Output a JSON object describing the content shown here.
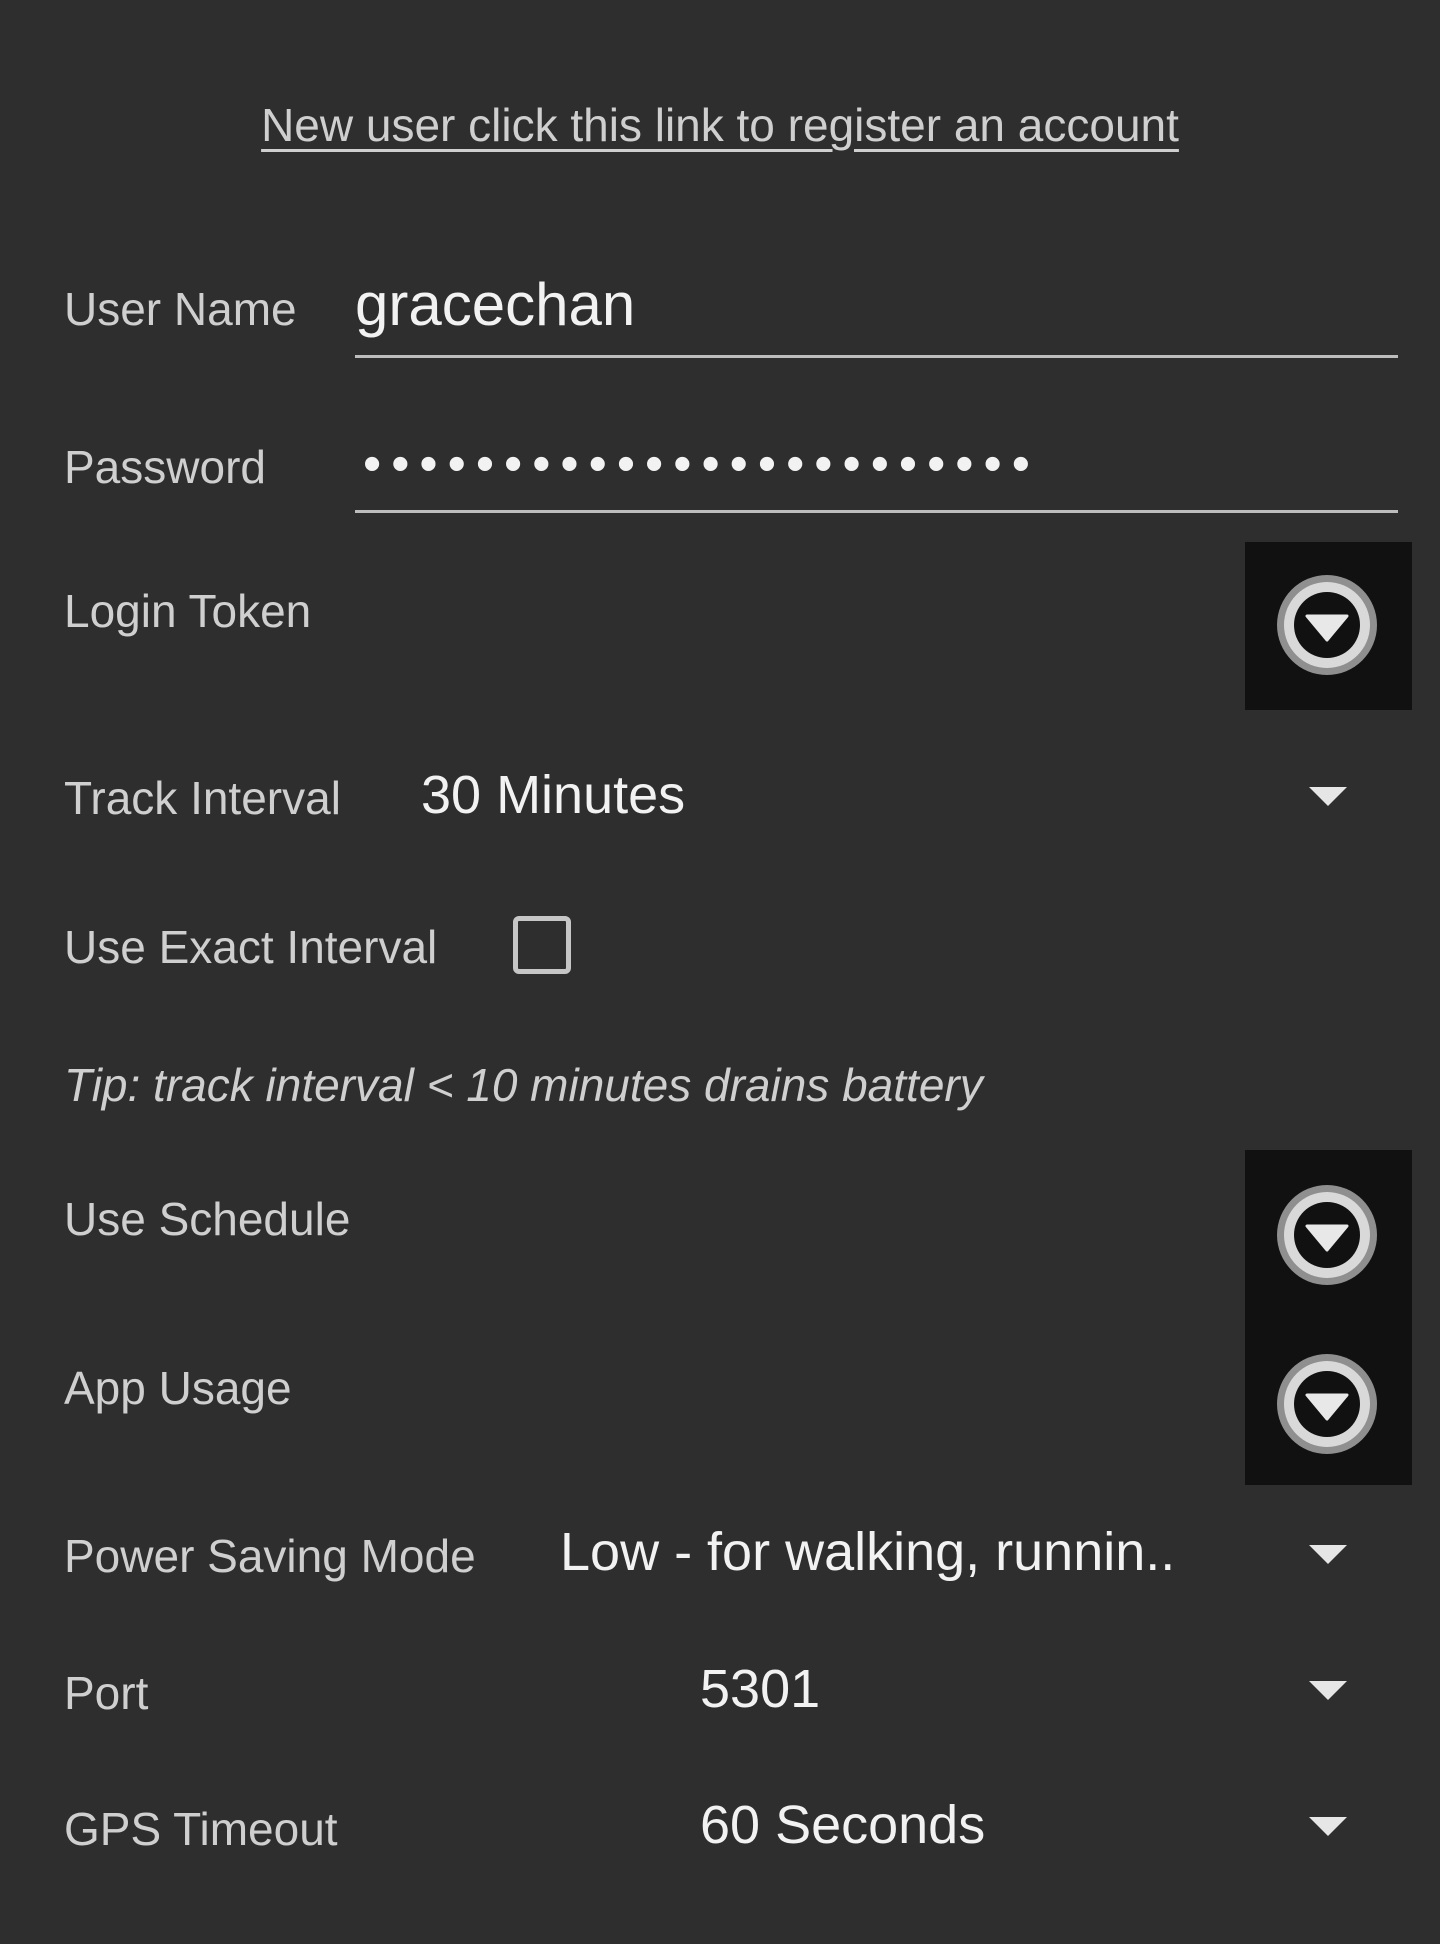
{
  "register_link": "New user click this link to register an account",
  "fields": {
    "username": {
      "label": "User Name",
      "value": "gracechan"
    },
    "password": {
      "label": "Password",
      "value": "••••••••••••••••••••••••"
    },
    "login_token": {
      "label": "Login Token",
      "icon": "chevron-down-circle-icon"
    },
    "track_interval": {
      "label": "Track Interval",
      "value": "30 Minutes"
    },
    "use_exact_interval": {
      "label": "Use Exact Interval",
      "checked": false
    },
    "tip": "Tip: track interval < 10 minutes drains battery",
    "use_schedule": {
      "label": "Use Schedule",
      "icon": "chevron-down-circle-icon"
    },
    "app_usage": {
      "label": "App Usage",
      "icon": "chevron-down-circle-icon"
    },
    "power_saving_mode": {
      "label": "Power Saving Mode",
      "value": "Low - for walking, runnin.."
    },
    "port": {
      "label": "Port",
      "value": "5301"
    },
    "gps_timeout": {
      "label": "GPS Timeout",
      "value": "60 Seconds"
    }
  },
  "colors": {
    "background": "#2e2e2e",
    "panel": "#111111",
    "text": "#cfcfcf",
    "value_text": "#f2f2f2"
  }
}
